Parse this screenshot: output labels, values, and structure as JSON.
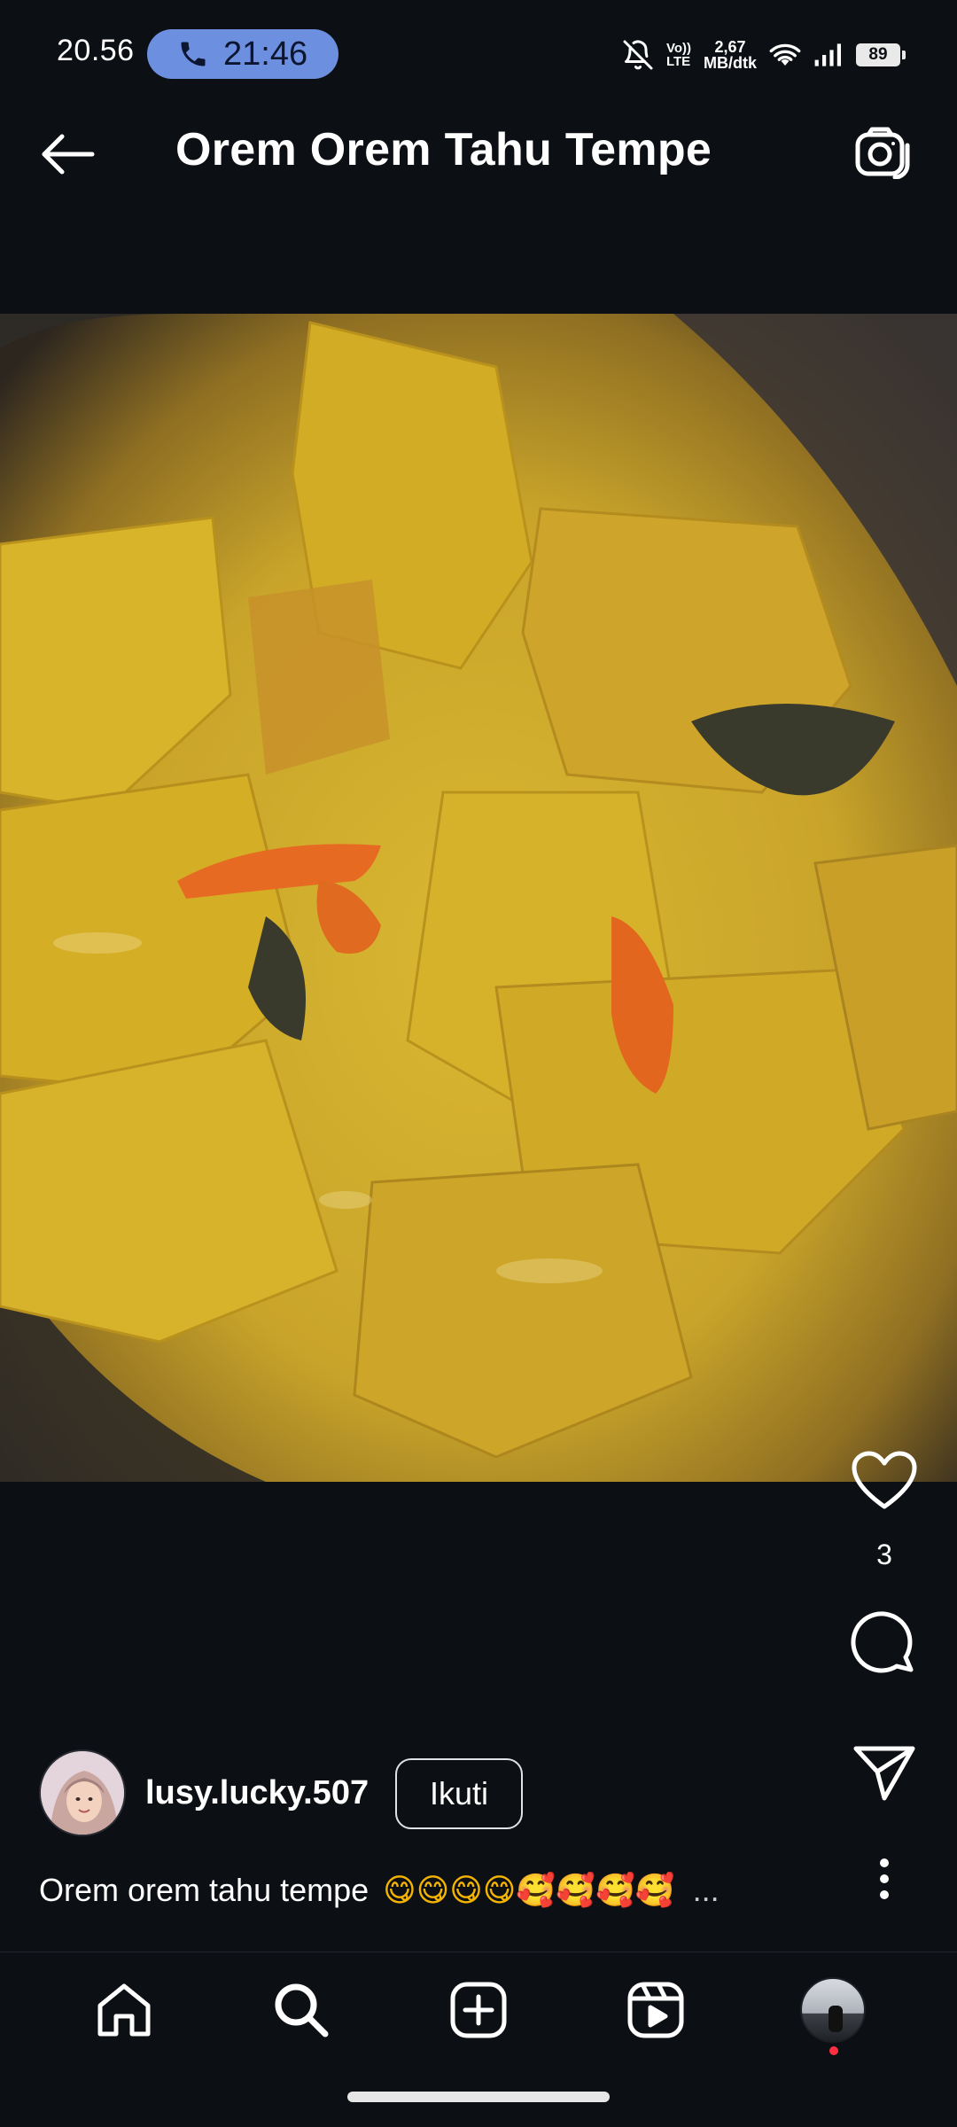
{
  "status_bar": {
    "time": "20.56",
    "call_timer": "21:46",
    "network_type_top": "Vo))",
    "network_type_bottom": "LTE",
    "net_speed_value": "2,67",
    "net_speed_unit": "MB/dtk",
    "battery": "89"
  },
  "header": {
    "title": "Orem Orem Tahu Tempe"
  },
  "post": {
    "like_count": "3",
    "author": "lusy.lucky.507",
    "follow_label": "Ikuti",
    "caption_text": "Orem orem tahu tempe",
    "caption_emojis": "😋😋😋😋🥰🥰🥰🥰",
    "caption_more": "..."
  },
  "icons": {
    "back": "arrow-left-icon",
    "camera": "camera-icon",
    "like": "heart-icon",
    "comment": "comment-icon",
    "share": "send-icon",
    "more": "more-vertical-icon",
    "nav": [
      "home-icon",
      "search-icon",
      "create-icon",
      "reels-icon",
      "profile-avatar"
    ]
  },
  "colors": {
    "background": "#0c0f14",
    "call_pill": "#6d8fe0",
    "accent_red": "#ff3040"
  }
}
